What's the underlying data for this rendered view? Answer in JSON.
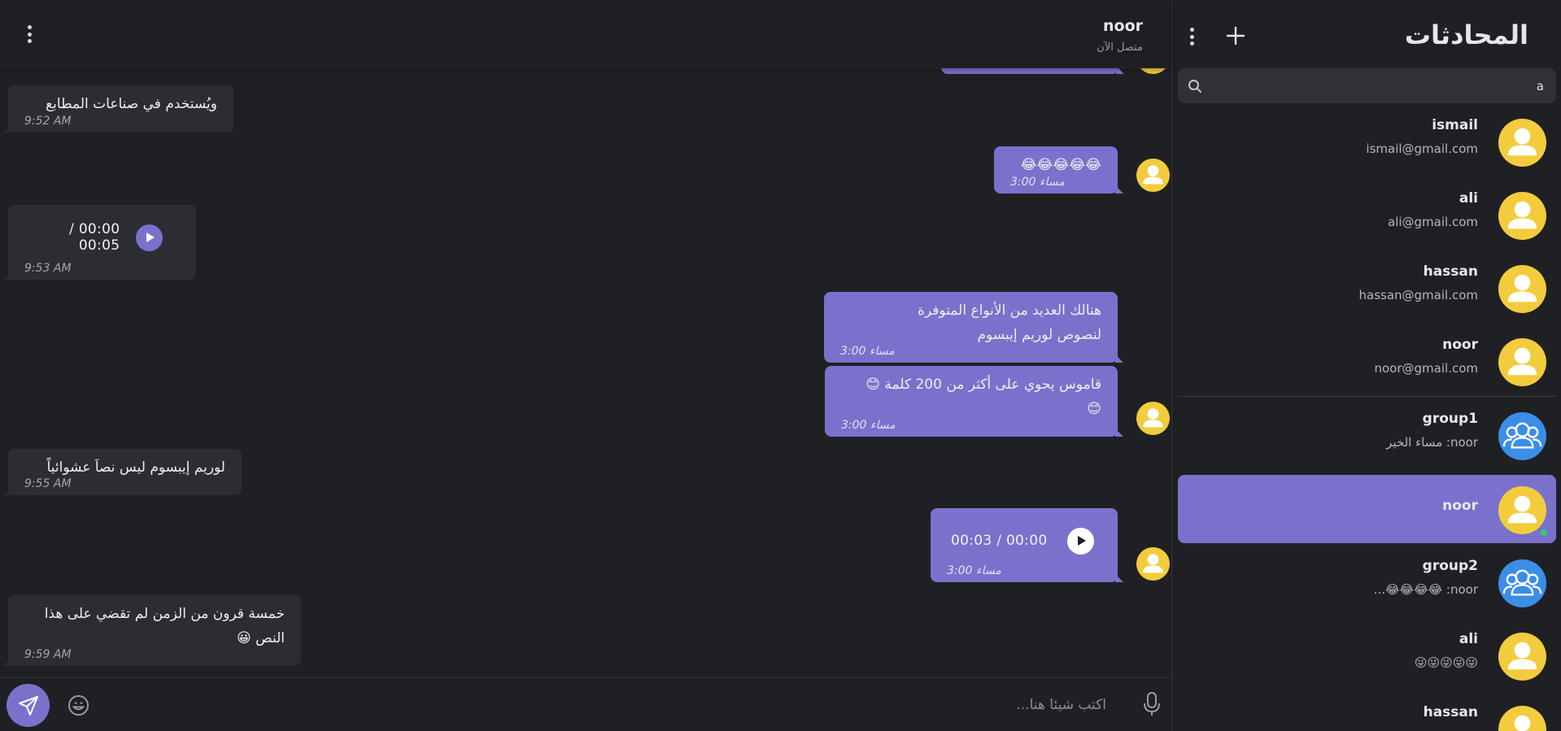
{
  "colors": {
    "background": "#1f2024",
    "accent": "#7a71cc",
    "incoming_bubble": "#2c2d32",
    "avatar_yellow": "#f3cc3d",
    "group_blue": "#3b8ee6",
    "online_green": "#2ecc71"
  },
  "chat": {
    "header": {
      "name": "noor",
      "status": "متصل الآن",
      "menu_icon": "kebab-menu-icon"
    },
    "messages": [
      {
        "direction": "in",
        "text": "ويُستخدم في صناعات المطابع",
        "time": "9:52 AM"
      },
      {
        "direction": "out",
        "text": "😂😂😂😂😂",
        "time": "3:00 مساء"
      },
      {
        "direction": "in",
        "type": "audio",
        "duration": "00:00 / 00:05",
        "time": "9:53 AM"
      },
      {
        "direction": "out",
        "text_lines": [
          "هنالك العديد من الأنواع المتوفرة",
          "لنصوص لوريم إيبسوم"
        ],
        "time": "3:00 مساء"
      },
      {
        "direction": "out",
        "text_lines": [
          "قاموس يحوي على أكثر من 200 كلمة 😊",
          "😊"
        ],
        "time": "3:00 مساء"
      },
      {
        "direction": "in",
        "text": "لوريم إيبسوم ليس نصاَ عشوائياً",
        "time": "9:55 AM"
      },
      {
        "direction": "out",
        "type": "audio",
        "duration": "00:00 / 00:03",
        "time": "3:00 مساء"
      },
      {
        "direction": "in",
        "text_lines": [
          "خمسة قرون من الزمن لم تقضي على هذا",
          "النص 😀"
        ],
        "time": "9:59 AM"
      }
    ],
    "composer": {
      "placeholder": "اكتب شيئا هنا...",
      "send_icon": "send-icon",
      "emoji_icon": "emoji-icon",
      "mic_icon": "microphone-icon"
    }
  },
  "sidebar": {
    "title": "المحادثات",
    "add_icon": "plus-icon",
    "menu_icon": "kebab-menu-icon",
    "search": {
      "value": "a",
      "icon": "search-icon"
    },
    "contacts": [
      {
        "name": "ismail",
        "subtitle": "ismail@gmail.com",
        "type": "user"
      },
      {
        "name": "ali",
        "subtitle": "ali@gmail.com",
        "type": "user"
      },
      {
        "name": "hassan",
        "subtitle": "hassan@gmail.com",
        "type": "user"
      },
      {
        "name": "noor",
        "subtitle": "noor@gmail.com",
        "type": "user"
      }
    ],
    "conversations": [
      {
        "name": "group1",
        "sender": "noor",
        "preview": "مساء الخير",
        "type": "group"
      },
      {
        "name": "noor",
        "subtitle": "",
        "type": "user",
        "active": true,
        "online": true
      },
      {
        "name": "group2",
        "sender": "noor",
        "preview": "😂😂😂😂...",
        "type": "group"
      },
      {
        "name": "ali",
        "subtitle": "😜😜😜😜😜",
        "type": "user"
      },
      {
        "name": "hassan",
        "subtitle": "",
        "type": "user"
      }
    ]
  }
}
